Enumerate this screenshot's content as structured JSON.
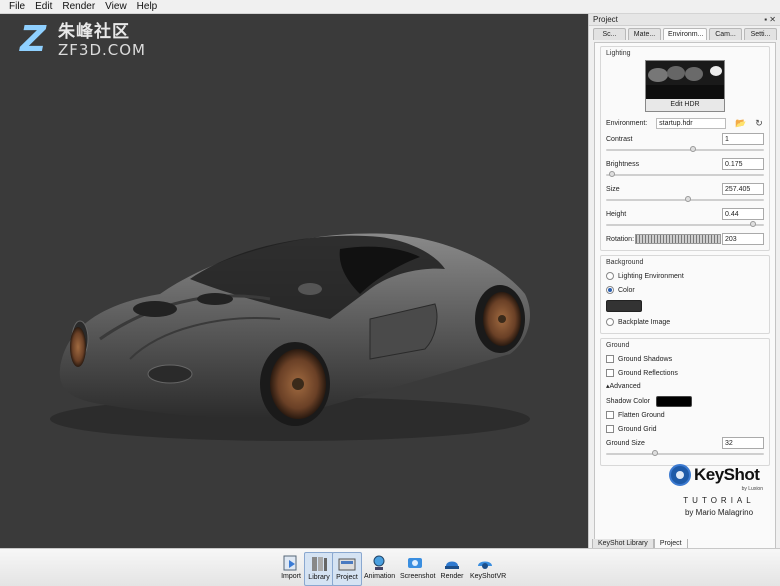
{
  "menubar": {
    "items": [
      "File",
      "Edit",
      "Render",
      "View",
      "Help"
    ]
  },
  "watermark": {
    "cn": "朱峰社区",
    "en": "ZF3D.COM"
  },
  "panel": {
    "title": "Project",
    "controls": "▪ ✕",
    "tabs": [
      "Sc...",
      "Mate...",
      "Environm...",
      "Cam...",
      "Setti..."
    ],
    "active_tab": "Environm...",
    "lighting": {
      "title": "Lighting",
      "edit_hdr_label": "Edit HDR",
      "environment_label": "Environment:",
      "environment_value": "startup.hdr",
      "contrast_label": "Contrast",
      "contrast_value": "1",
      "contrast_level": 0.55,
      "brightness_label": "Brightness",
      "brightness_value": "0.175",
      "brightness_level": 0.02,
      "size_label": "Size",
      "size_value": "257.405",
      "size_level": 0.52,
      "height_label": "Height",
      "height_value": "0.44",
      "height_level": 0.95,
      "rotation_label": "Rotation:",
      "rotation_value": "203"
    },
    "background": {
      "title": "Background",
      "options": [
        "Lighting Environment",
        "Color",
        "Backplate Image"
      ],
      "selected": "Color",
      "color": "#333333"
    },
    "ground": {
      "title": "Ground",
      "ground_shadows": "Ground Shadows",
      "ground_reflections": "Ground Reflections",
      "advanced": "▴Advanced",
      "shadow_color_label": "Shadow Color",
      "shadow_color": "#000000",
      "flatten_ground": "Flatten Ground",
      "ground_grid": "Ground Grid",
      "ground_size_label": "Ground Size",
      "ground_size_value": "32",
      "ground_size_level": 0.3
    },
    "branding": {
      "name": "KeyShot",
      "by": "by Luxion",
      "tutorial": "TUTORIAL",
      "author": "by Mario Malagrino"
    },
    "bottom_tabs": [
      "KeyShot Library",
      "Project"
    ],
    "active_bottom_tab": "Project"
  },
  "toolbar": {
    "items": [
      {
        "label": "Import",
        "icon": "import-icon"
      },
      {
        "label": "Library",
        "icon": "library-icon"
      },
      {
        "label": "Project",
        "icon": "project-icon"
      },
      {
        "label": "Animation",
        "icon": "animation-icon"
      },
      {
        "label": "Screenshot",
        "icon": "screenshot-icon"
      },
      {
        "label": "Render",
        "icon": "render-icon"
      },
      {
        "label": "KeyShotVR",
        "icon": "keyshotvr-icon"
      }
    ]
  }
}
